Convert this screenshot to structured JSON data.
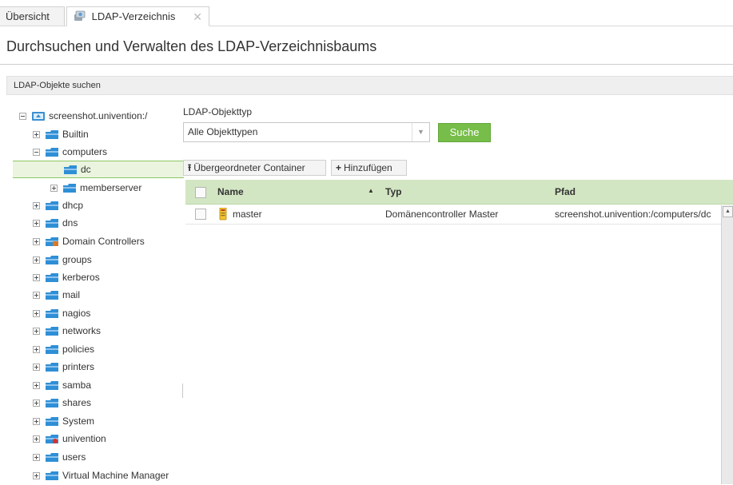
{
  "tabs": [
    {
      "label": "Übersicht"
    },
    {
      "label": "LDAP-Verzeichnis",
      "icon": "ldap-directory-icon",
      "close": "✕"
    }
  ],
  "page": {
    "title": "Durchsuchen und Verwalten des LDAP-Verzeichnisbaums"
  },
  "search_bar": {
    "label": "LDAP-Objekte suchen"
  },
  "tree": {
    "root": "screenshot.univention:/",
    "items": [
      {
        "label": "Builtin"
      },
      {
        "label": "computers"
      },
      {
        "label": "dc"
      },
      {
        "label": "memberserver"
      },
      {
        "label": "dhcp"
      },
      {
        "label": "dns"
      },
      {
        "label": "Domain Controllers"
      },
      {
        "label": "groups"
      },
      {
        "label": "kerberos"
      },
      {
        "label": "mail"
      },
      {
        "label": "nagios"
      },
      {
        "label": "networks"
      },
      {
        "label": "policies"
      },
      {
        "label": "printers"
      },
      {
        "label": "samba"
      },
      {
        "label": "shares"
      },
      {
        "label": "System"
      },
      {
        "label": "univention"
      },
      {
        "label": "users"
      },
      {
        "label": "Virtual Machine Manager"
      }
    ]
  },
  "filter": {
    "type_label": "LDAP-Objekttyp",
    "type_value": "Alle Objekttypen",
    "search_button": "Suche"
  },
  "toolbar": {
    "parent_button": "Übergeordneter Container",
    "add_button": "Hinzufügen"
  },
  "grid": {
    "columns": {
      "name": "Name",
      "typ": "Typ",
      "pfad": "Pfad"
    },
    "sort_indicator": "▲",
    "rows": [
      {
        "name": "master",
        "typ": "Domänencontroller Master",
        "pfad": "screenshot.univention:/computers/dc"
      }
    ]
  },
  "colors": {
    "accent_green": "#77bd4a",
    "header_green": "#d3e6c3",
    "selection_green": "#eaf4df",
    "folder_blue": "#2f8fd6"
  }
}
